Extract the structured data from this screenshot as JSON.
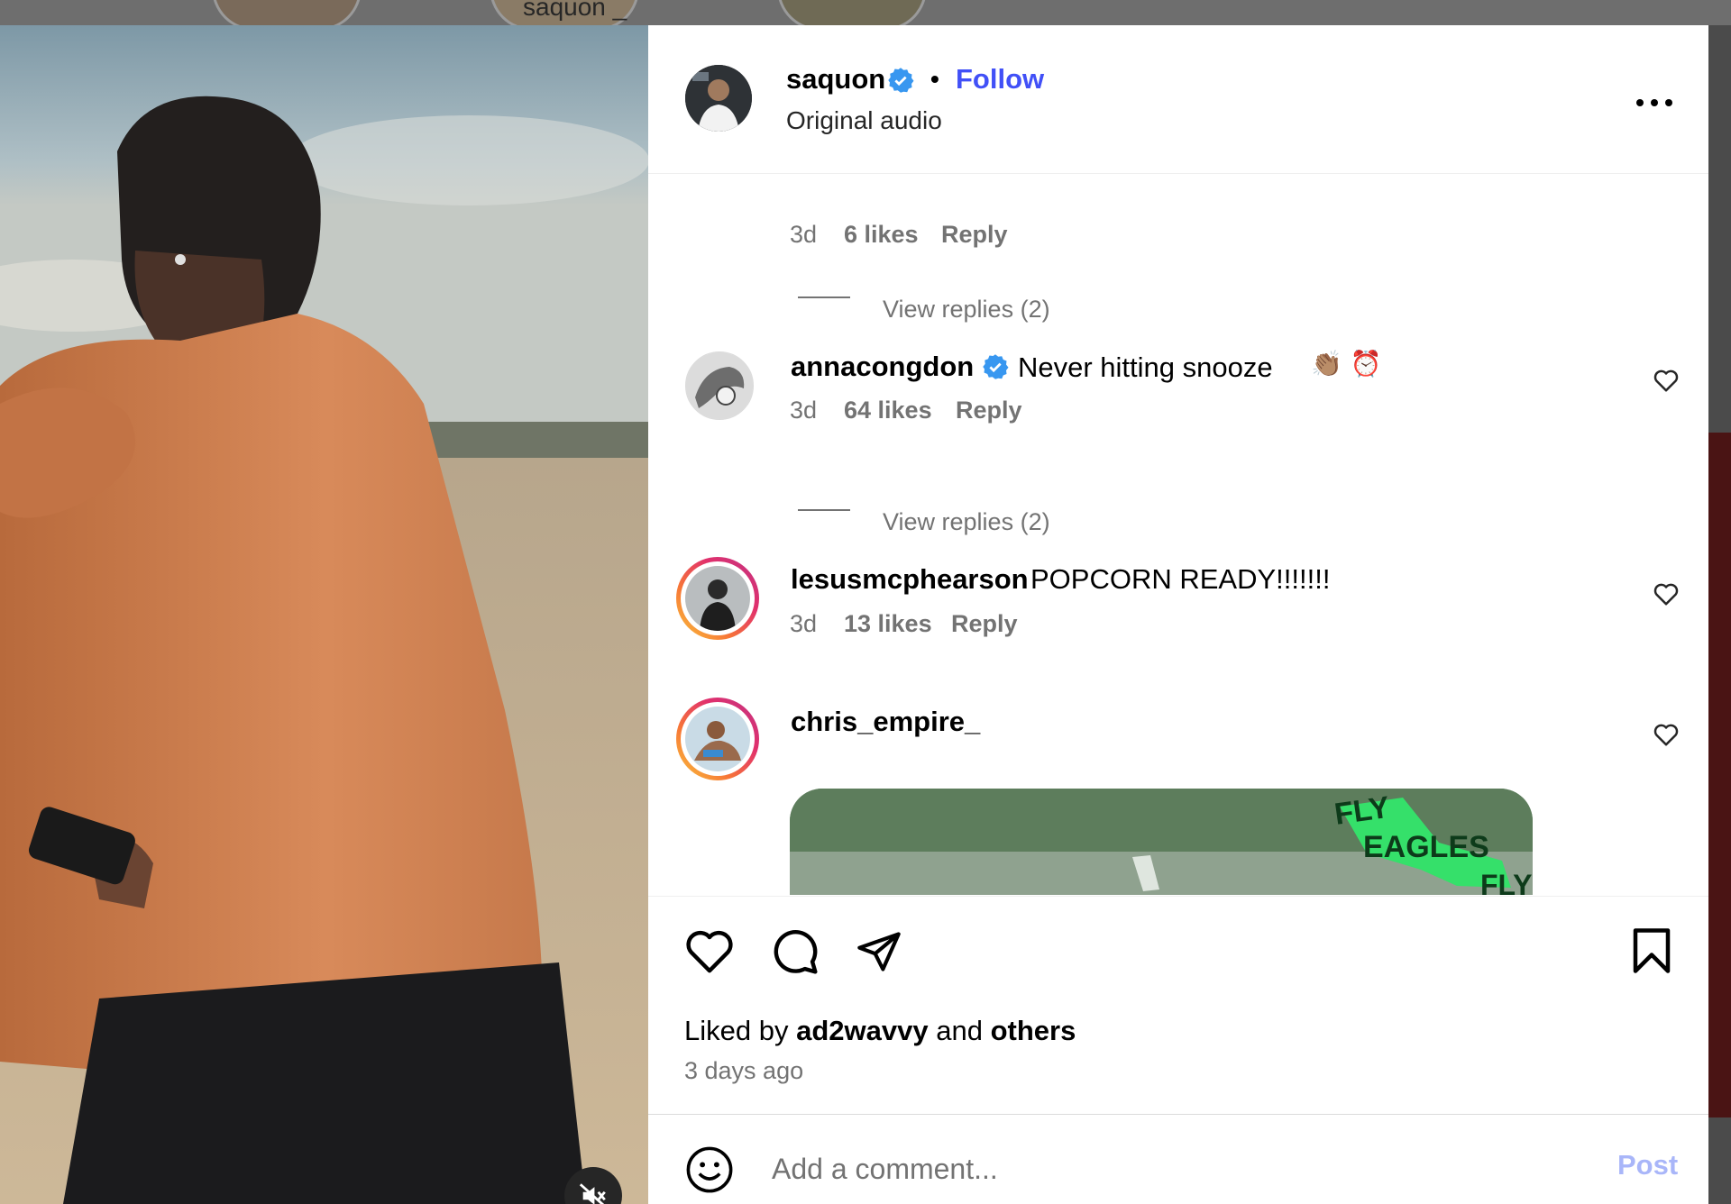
{
  "background": {
    "strip_username": "saquon _"
  },
  "post": {
    "author": "saquon",
    "follow_label": "Follow",
    "separator": "•",
    "audio_label": "Original audio"
  },
  "comments": [
    {
      "time": "3d",
      "likes": "6 likes",
      "reply": "Reply",
      "view_replies": "View replies (2)"
    },
    {
      "username": "annacongdon",
      "text": "Never hitting snooze",
      "emoji": "👏🏽 ⏰",
      "time": "3d",
      "likes": "64 likes",
      "reply": "Reply",
      "view_replies": "View replies (2)"
    },
    {
      "username": "lesusmcphearson",
      "text": "POPCORN READY!!!!!!!",
      "time": "3d",
      "likes": "13 likes",
      "reply": "Reply"
    },
    {
      "username": "chris_empire_",
      "gif_text": [
        "FLY",
        "EAGLES",
        "FLY"
      ]
    }
  ],
  "footer": {
    "liked_prefix": "Liked by",
    "liked_user": "ad2wavvy",
    "liked_and": "and",
    "liked_others": "others",
    "ago": "3 days ago",
    "comment_placeholder": "Add a comment...",
    "post_label": "Post"
  },
  "colors": {
    "follow": "#4150f7",
    "verified": "#3897f0",
    "muted_text": "#737373",
    "post_disabled": "#a9b6f9"
  }
}
